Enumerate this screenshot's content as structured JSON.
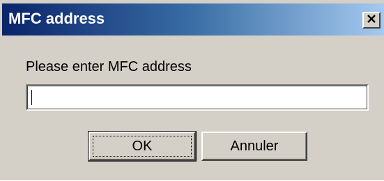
{
  "window": {
    "title": "MFC address"
  },
  "titlebar": {
    "close_icon": "close-x-icon",
    "colors": {
      "gradient_start": "#0a246a",
      "gradient_end": "#a6caf0",
      "text": "#ffffff"
    }
  },
  "form": {
    "prompt": "Please enter MFC address",
    "address_value": ""
  },
  "buttons": {
    "ok_label": "OK",
    "cancel_label": "Annuler"
  },
  "colors": {
    "face": "#d4d0c8",
    "input_bg": "#ffffff"
  }
}
